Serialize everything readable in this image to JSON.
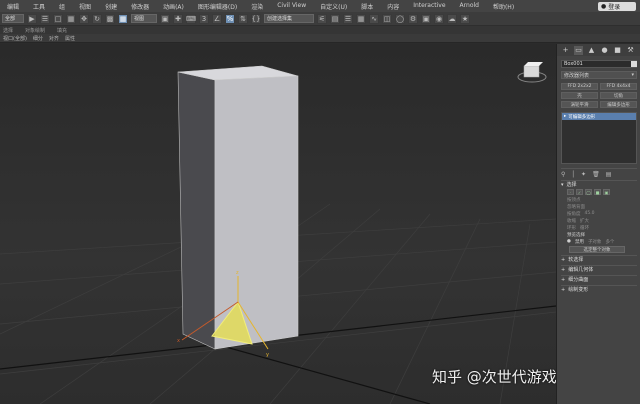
{
  "menubar": {
    "items": [
      "编辑",
      "工具",
      "组",
      "视图",
      "创建",
      "修改器",
      "动画(A)",
      "图形编辑器(D)",
      "渲染",
      "Civil View",
      "自定义(U)",
      "脚本",
      "内容",
      "Interactive",
      "Arnold",
      "帮助(H)"
    ],
    "login_label": "登录"
  },
  "toolbar": {
    "selection_filter": "全部",
    "view_label": "视图",
    "selection_set": "创建选择集"
  },
  "tabbar": {
    "tabs": [
      "选择",
      "对象绘制",
      "填充"
    ]
  },
  "subbar": {
    "items": [
      "视口(全部)",
      "细分",
      "对齐",
      "属性"
    ]
  },
  "command_panel": {
    "object_name": "Box001",
    "modifier_list": "修改器列表",
    "buttons": [
      "FFD 2x2x2",
      "FFD 4x4x4",
      "壳",
      "切角",
      "涡轮平滑",
      "编辑多边形"
    ],
    "stack_item": "可编辑多边形",
    "selection": {
      "title": "选择",
      "lines": [
        "按顶点",
        "忽略背面",
        "按角度",
        "收缩",
        "扩大",
        "环形",
        "循环"
      ],
      "preview_label": "预览选择",
      "preview_option": "禁用",
      "preview_option_b": "子对象",
      "preview_option_c": "多个",
      "select_whole_btn": "选定整个对象",
      "angle_value": "45.0"
    },
    "rollouts": [
      "软选择",
      "编辑几何体",
      "细分曲面",
      "绘制变形"
    ]
  },
  "viewport": {
    "axis_labels": {
      "x": "x",
      "y": "y",
      "z": "z"
    }
  },
  "watermark": "知乎 @次世代游戏建模",
  "colors": {
    "selected_face": "#e8e04a",
    "box_face": "#bfbfc4",
    "active_tab": "#5a7fae"
  }
}
